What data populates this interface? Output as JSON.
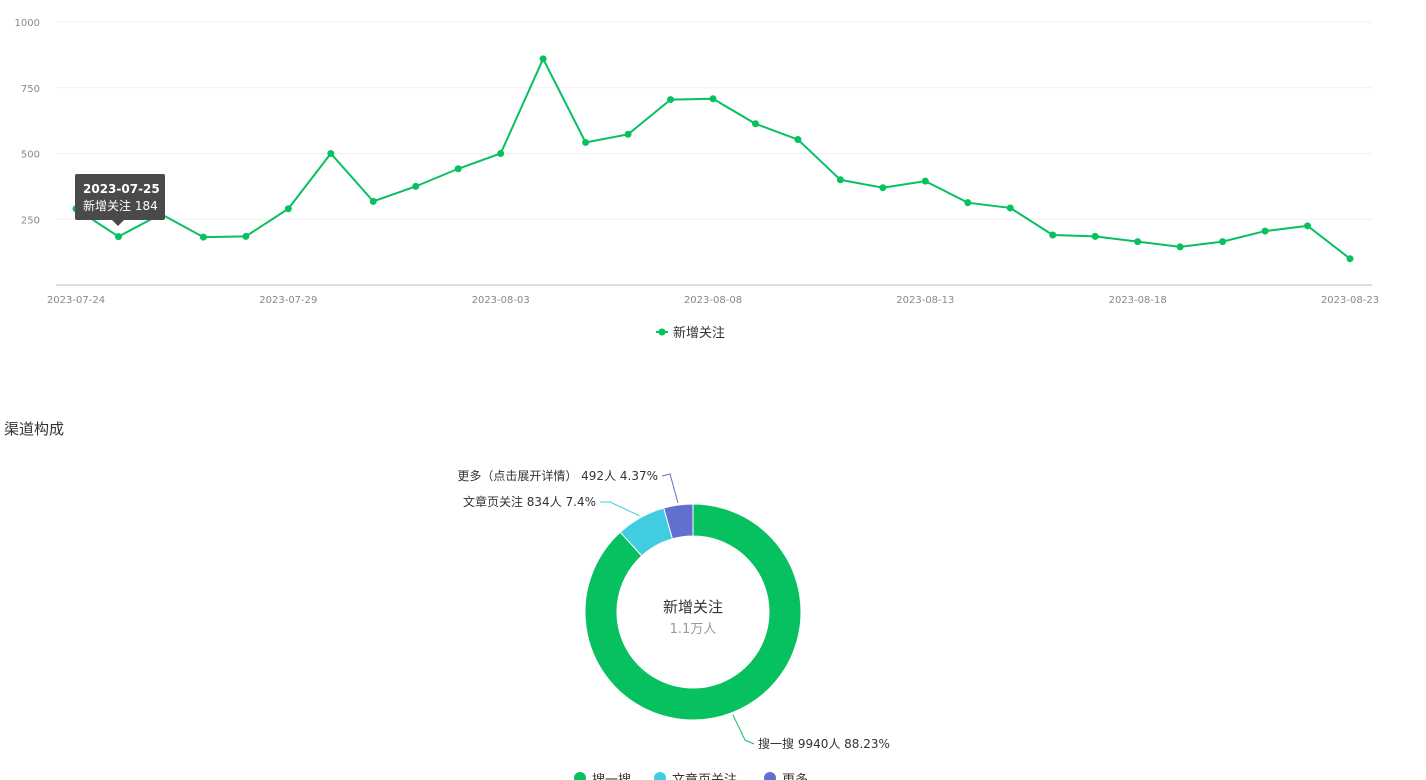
{
  "chart_data": [
    {
      "type": "line",
      "x": [
        "2023-07-24",
        "2023-07-25",
        "2023-07-26",
        "2023-07-27",
        "2023-07-28",
        "2023-07-29",
        "2023-07-30",
        "2023-07-31",
        "2023-08-01",
        "2023-08-02",
        "2023-08-03",
        "2023-08-04",
        "2023-08-05",
        "2023-08-06",
        "2023-08-07",
        "2023-08-08",
        "2023-08-09",
        "2023-08-10",
        "2023-08-11",
        "2023-08-12",
        "2023-08-13",
        "2023-08-14",
        "2023-08-15",
        "2023-08-16",
        "2023-08-17",
        "2023-08-18",
        "2023-08-19",
        "2023-08-20",
        "2023-08-21",
        "2023-08-22",
        "2023-08-23"
      ],
      "series": [
        {
          "name": "新增关注",
          "values": [
            290,
            184,
            270,
            182,
            185,
            290,
            500,
            318,
            375,
            442,
            500,
            860,
            542,
            573,
            705,
            708,
            613,
            553,
            400,
            370,
            395,
            313,
            293,
            190,
            185,
            165,
            145,
            165,
            205,
            225,
            100
          ],
          "color": "#07c160"
        }
      ],
      "xticks": [
        "2023-07-24",
        "2023-07-29",
        "2023-08-03",
        "2023-08-08",
        "2023-08-13",
        "2023-08-18",
        "2023-08-23"
      ],
      "yticks": [
        "1000",
        "750",
        "500",
        "250"
      ],
      "ylim": [
        0,
        1000
      ],
      "grid": true,
      "legend_position": "bottom-center",
      "tooltip": {
        "date": "2023-07-25",
        "text": "新增关注 184"
      }
    },
    {
      "type": "pie",
      "variant": "donut",
      "title": "渠道构成",
      "center_label": "新增关注",
      "center_value": "1.1万人",
      "slices": [
        {
          "name": "搜一搜",
          "value": 9940,
          "percent": 88.23,
          "label": "搜一搜 9940人 88.23%",
          "color": "#07c160"
        },
        {
          "name": "文章页关注",
          "value": 834,
          "percent": 7.4,
          "label": "文章页关注 834人 7.4%",
          "color": "#40cde2"
        },
        {
          "name": "更多",
          "value": 492,
          "percent": 4.37,
          "label": "更多（点击展开详情） 492人 4.37%",
          "color": "#6070cc"
        }
      ],
      "legend_position": "bottom-center"
    }
  ]
}
